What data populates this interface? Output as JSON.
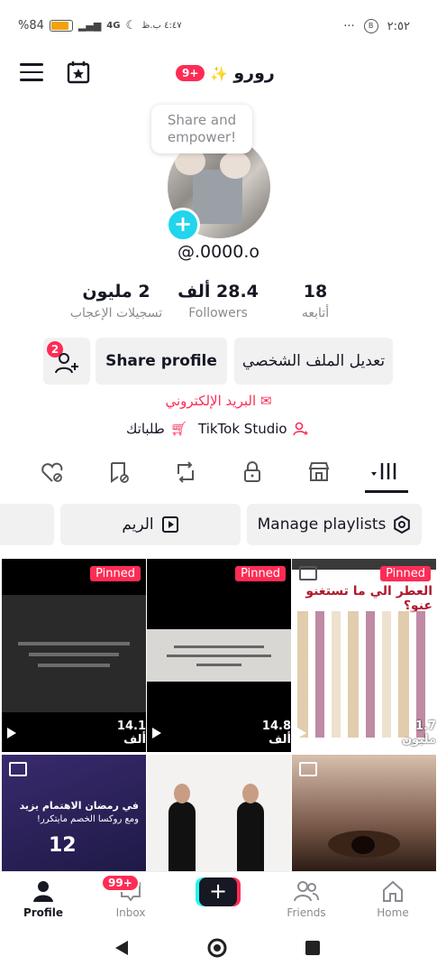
{
  "status_bar": {
    "battery": "%84",
    "network": "4G",
    "left_time_small": "٤:٤٧ ب.ظ",
    "right_dots": "···",
    "right_icon": "B",
    "time": "٢:٥٢"
  },
  "header": {
    "notif_count": "9+",
    "sparkle": "✨",
    "username": "رورو"
  },
  "profile": {
    "bubble_text": "Share and empower!",
    "handle": "@.0000.o",
    "stats": [
      {
        "num": "18",
        "label": "أتابعه"
      },
      {
        "num": "28.4 ألف",
        "label": "Followers"
      },
      {
        "num": "2 مليون",
        "label": "تسجيلات الإعجاب"
      }
    ],
    "add_friends_count": "2",
    "share_button": "Share profile",
    "edit_button": "تعديل الملف الشخصي",
    "email_link": "البريد الإلكتروني",
    "studio_link": "TikTok Studio",
    "orders_link": "طلباتك"
  },
  "tabs": [
    "videos",
    "shop",
    "private",
    "reposts",
    "favorites",
    "liked"
  ],
  "playlists": {
    "manage": "Manage playlists",
    "playlist1": "الريم"
  },
  "grid": [
    {
      "pinned": "Pinned",
      "views": "14.1 ألف",
      "type": "video"
    },
    {
      "pinned": "Pinned",
      "views": "14.8 ألف",
      "type": "video"
    },
    {
      "pinned": "Pinned",
      "views": "1.7 مليون",
      "type": "photo",
      "title": "العطر الي ما تستغنو عنو؟"
    },
    {
      "type": "photo",
      "title": "في رمضان الاهتمام يزيد",
      "subtitle": "ومع روكسا الخصم مايتكرر!",
      "badge": "12"
    },
    {
      "type": "video"
    },
    {
      "type": "photo"
    }
  ],
  "bottom_nav": {
    "profile": "Profile",
    "inbox": "Inbox",
    "inbox_badge": "99+",
    "friends": "Friends",
    "home": "Home"
  },
  "colors": {
    "accent": "#fe2c55",
    "cyan": "#25f4ee",
    "text": "#161823",
    "muted": "#8a8b91"
  }
}
